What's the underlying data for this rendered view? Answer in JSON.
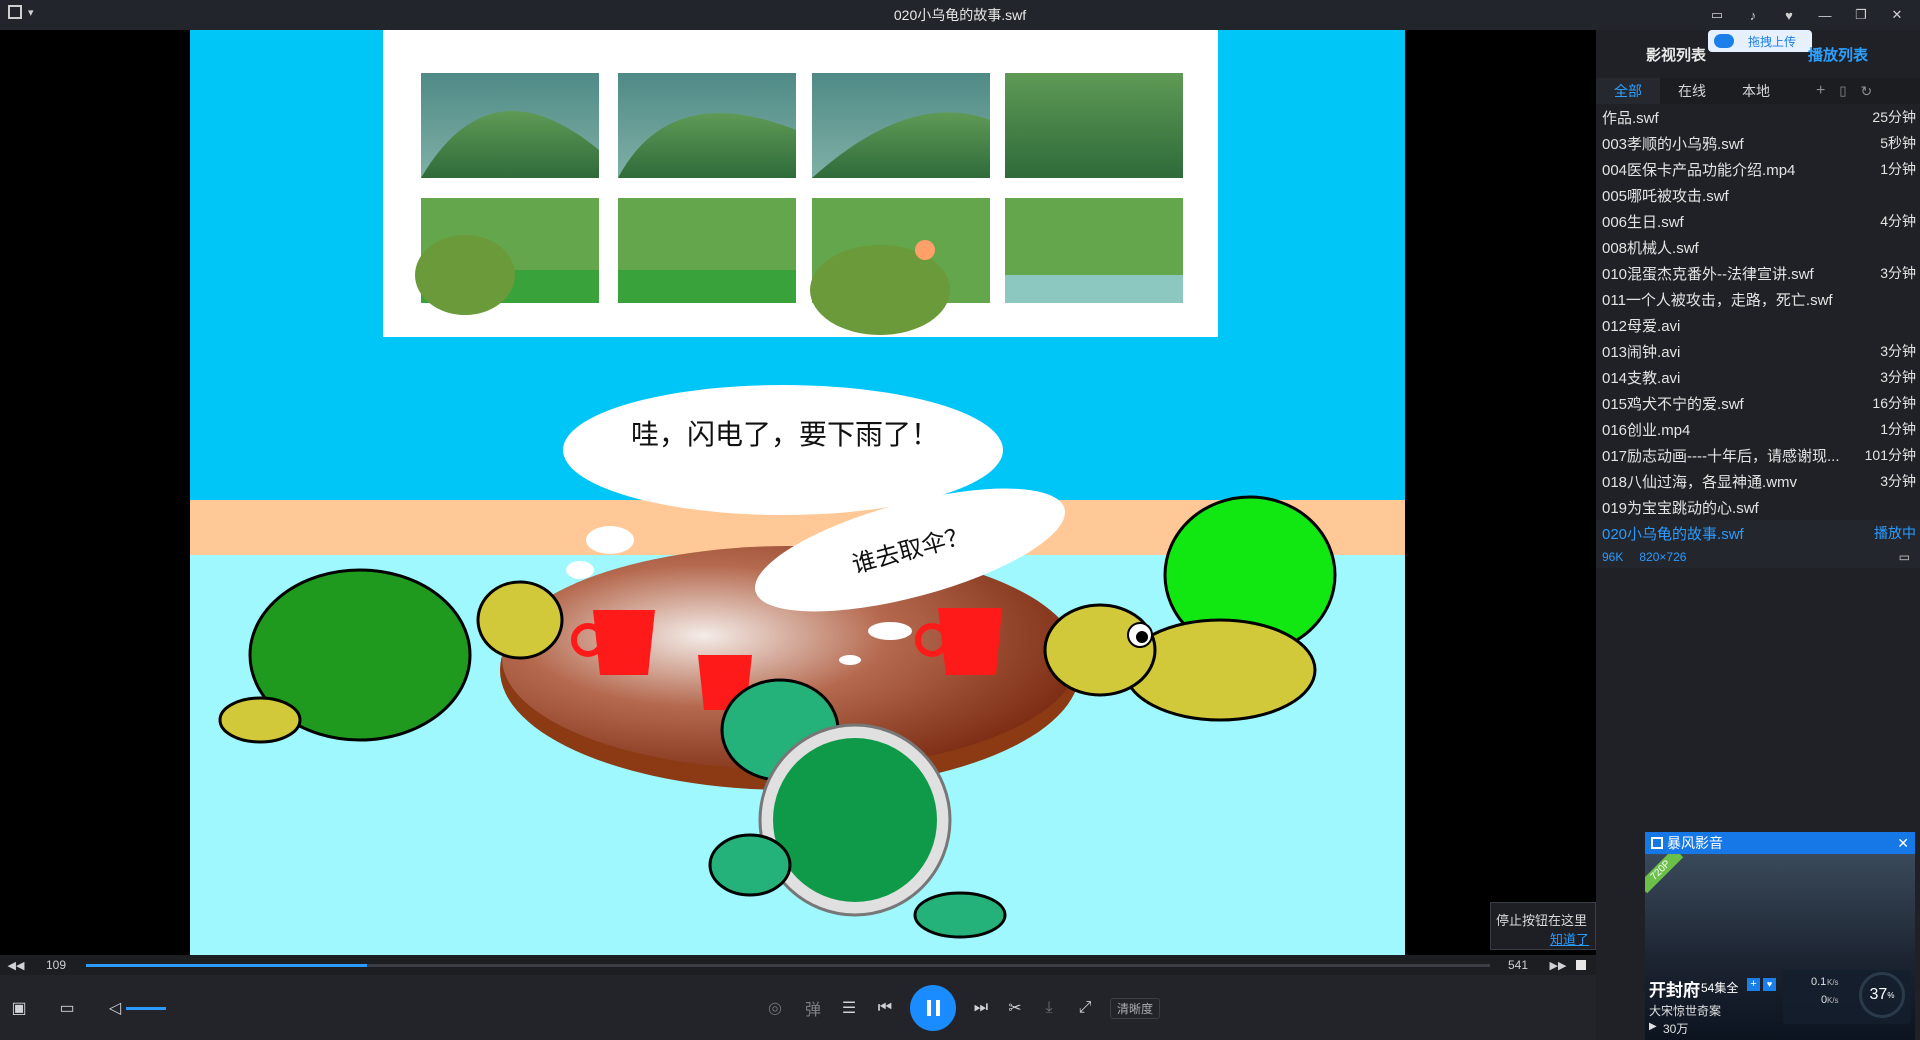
{
  "window": {
    "title": "020小乌龟的故事.swf"
  },
  "scene": {
    "speech_bubble_1": "哇，闪电了，要下雨了！",
    "speech_bubble_2": "谁去取伞？"
  },
  "playback": {
    "current_time": "109",
    "total_time": "541",
    "progress": 0.2
  },
  "controls": {
    "danmaku_label": "弹",
    "quality_label": "清晰度"
  },
  "tooltip": {
    "text": "停止按钮在这里",
    "link": "知道了"
  },
  "panel": {
    "cloud_upload": "拖拽上传",
    "title_left": "影视列表",
    "title_right": "播放列表",
    "tabs": [
      "全部",
      "在线",
      "本地"
    ],
    "items": [
      {
        "name": "作品.swf",
        "duration": "25分钟"
      },
      {
        "name": "003孝顺的小乌鸦.swf",
        "duration": "5秒钟"
      },
      {
        "name": "004医保卡产品功能介绍.mp4",
        "duration": "1分钟"
      },
      {
        "name": "005哪吒被攻击.swf",
        "duration": ""
      },
      {
        "name": "006生日.swf",
        "duration": "4分钟"
      },
      {
        "name": "008机械人.swf",
        "duration": ""
      },
      {
        "name": "010混蛋杰克番外--法律宣讲.swf",
        "duration": "3分钟"
      },
      {
        "name": "011一个人被攻击，走路，死亡.swf",
        "duration": ""
      },
      {
        "name": "012母爱.avi",
        "duration": ""
      },
      {
        "name": "013闹钟.avi",
        "duration": "3分钟"
      },
      {
        "name": "014支教.avi",
        "duration": "3分钟"
      },
      {
        "name": "015鸡犬不宁的爱.swf",
        "duration": "16分钟"
      },
      {
        "name": "016创业.mp4",
        "duration": "1分钟"
      },
      {
        "name": "017励志动画----十年后，请感谢现...",
        "duration": "101分钟"
      },
      {
        "name": "018八仙过海，各显神通.wmv",
        "duration": "3分钟"
      },
      {
        "name": "019为宝宝跳动的心.swf",
        "duration": ""
      },
      {
        "name": "020小乌龟的故事.swf",
        "duration": "播放中"
      }
    ],
    "playing_meta": {
      "size": "96K",
      "resolution": "820×726"
    }
  },
  "popup": {
    "brand": "暴风影音",
    "badge": "720P",
    "show_title": "开封府",
    "episodes": "54集全",
    "subtitle": "大宋惊世奇案",
    "views": "30万",
    "speed_up": "0.1",
    "speed_down": "0",
    "speed_unit": "K/s",
    "percent": "37"
  },
  "colors": {
    "accent": "#2b9bff",
    "play_button": "#1a8cff"
  }
}
